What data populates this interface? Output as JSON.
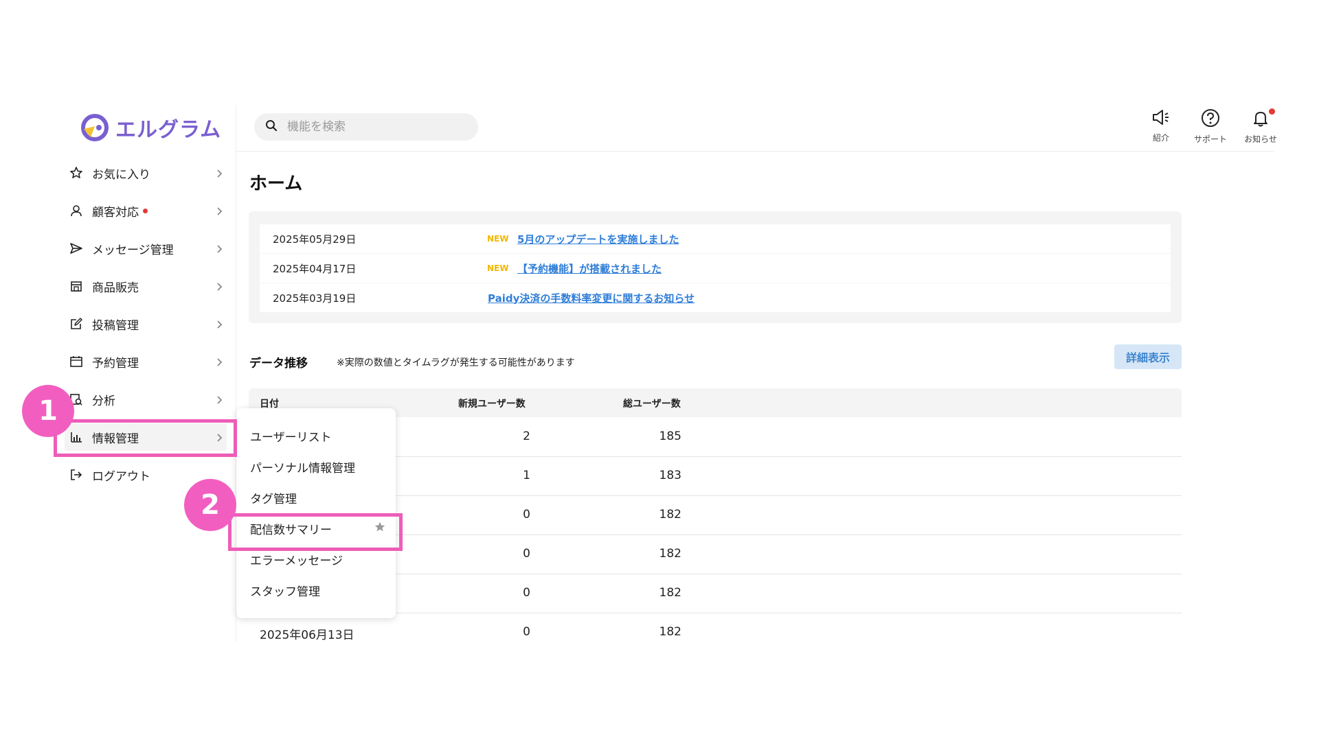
{
  "app": {
    "logo_text": "エルグラム",
    "logo_color": "#7a5fd0"
  },
  "search": {
    "placeholder": "機能を検索",
    "icon": "search-icon"
  },
  "header_buttons": [
    {
      "label": "紹介",
      "icon": "megaphone-icon"
    },
    {
      "label": "サポート",
      "icon": "help-circle-icon"
    },
    {
      "label": "お知らせ",
      "icon": "bell-icon"
    }
  ],
  "sidebar": {
    "items": [
      {
        "label": "お気に入り",
        "icon": "star-icon"
      },
      {
        "label": "顧客対応",
        "icon": "user-icon"
      },
      {
        "label": "メッセージ管理",
        "icon": "send-icon"
      },
      {
        "label": "商品販売",
        "icon": "store-icon"
      },
      {
        "label": "投稿管理",
        "icon": "edit-icon"
      },
      {
        "label": "予約管理",
        "icon": "calendar-icon"
      },
      {
        "label": "分析",
        "icon": "analytics-icon"
      },
      {
        "label": "情報管理",
        "icon": "bar-chart-icon"
      },
      {
        "label": "ログアウト",
        "icon": "logout-icon"
      }
    ]
  },
  "submenu": {
    "items": [
      "ユーザーリスト",
      "パーソナル情報管理",
      "タグ管理",
      "配信数サマリー",
      "エラーメッセージ",
      "スタッフ管理"
    ]
  },
  "annotations": {
    "step1": "1",
    "step2": "2",
    "highlight_color": "#ee5db8"
  },
  "main": {
    "title": "ホーム",
    "notices": [
      {
        "date": "2025年05月29日",
        "new": "NEW",
        "text": "5月のアップデートを実施しました"
      },
      {
        "date": "2025年04月17日",
        "new": "NEW",
        "text": "【予約機能】が搭載されました"
      },
      {
        "date": "2025年03月19日",
        "new": "",
        "text": "Paidy決済の手数料率変更に関するお知らせ"
      }
    ],
    "data_section": {
      "title": "データ推移",
      "note": "※実際の数値とタイムラグが発生する可能性があります",
      "detail_button": "詳細表示"
    },
    "table": {
      "headers": [
        "日付",
        "新規ユーザー数",
        "総ユーザー数"
      ],
      "rows": [
        {
          "date": "",
          "new_users": "2",
          "total_users": "185"
        },
        {
          "date": "",
          "new_users": "1",
          "total_users": "183"
        },
        {
          "date": "",
          "new_users": "0",
          "total_users": "182"
        },
        {
          "date": "",
          "new_users": "0",
          "total_users": "182"
        },
        {
          "date": "",
          "new_users": "0",
          "total_users": "182"
        },
        {
          "date": "2025年06月13日",
          "new_users": "0",
          "total_users": "182"
        }
      ]
    }
  }
}
